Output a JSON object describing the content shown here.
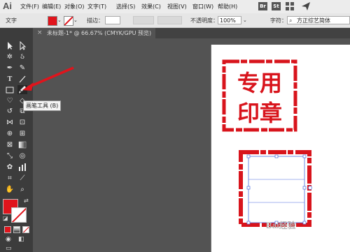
{
  "app": {
    "logo": "Ai"
  },
  "menu": [
    "文件(F)",
    "编辑(E)",
    "对象(O)",
    "文字(T)",
    "选择(S)",
    "效果(C)",
    "视图(V)",
    "窗口(W)",
    "帮助(H)"
  ],
  "bridge_label": "Br",
  "stock_label": "St",
  "control": {
    "tool_label": "文字",
    "stroke_label": "描边：",
    "opacity_label": "不透明度：",
    "opacity_value": "100%",
    "char_label": "字符：",
    "font_value": "方正综艺简体"
  },
  "tab": {
    "close": "×",
    "title": "未标题-1* @ 66.67% (CMYK/GPU 预览)"
  },
  "tooltip": "画笔工具 (B)",
  "stamp": {
    "line1": "专用",
    "line2": "印章"
  },
  "watermark": "Bai经验",
  "colors": {
    "fill": "#e0141c",
    "stroke": "#e0141c",
    "selection": "#4a6fe0"
  }
}
